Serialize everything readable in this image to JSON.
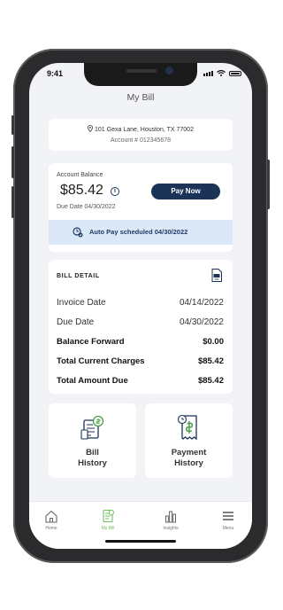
{
  "status_bar": {
    "time": "9:41"
  },
  "page_title": "My Bill",
  "address": {
    "line": "101 Gexa Lane, Houston, TX 77002",
    "account": "Account #  012345678"
  },
  "balance": {
    "label": "Account Balance",
    "amount": "$85.42",
    "due": "Due Date 04/30/2022",
    "pay_button": "Pay Now",
    "autopay": "Auto Pay scheduled 04/30/2022"
  },
  "bill_detail": {
    "heading": "BILL DETAIL",
    "rows": [
      {
        "label": "Invoice Date",
        "value": "04/14/2022"
      },
      {
        "label": "Due Date",
        "value": "04/30/2022"
      },
      {
        "label": "Balance Forward",
        "value": "$0.00"
      },
      {
        "label": "Total Current Charges",
        "value": "$85.42"
      },
      {
        "label": "Total Amount Due",
        "value": "$85.42"
      }
    ]
  },
  "tiles": [
    {
      "line1": "Bill",
      "line2": "History"
    },
    {
      "line1": "Payment",
      "line2": "History"
    }
  ],
  "tabs": [
    {
      "label": "Home",
      "icon": "home-icon"
    },
    {
      "label": "My Bill",
      "icon": "bill-icon"
    },
    {
      "label": "Insights",
      "icon": "bar-chart-icon"
    },
    {
      "label": "Menu",
      "icon": "hamburger-icon"
    }
  ],
  "colors": {
    "primary": "#1c3358",
    "accent": "#6fbf5b",
    "autopay_bg": "#dbe8f8",
    "background": "#f1f3f6"
  }
}
